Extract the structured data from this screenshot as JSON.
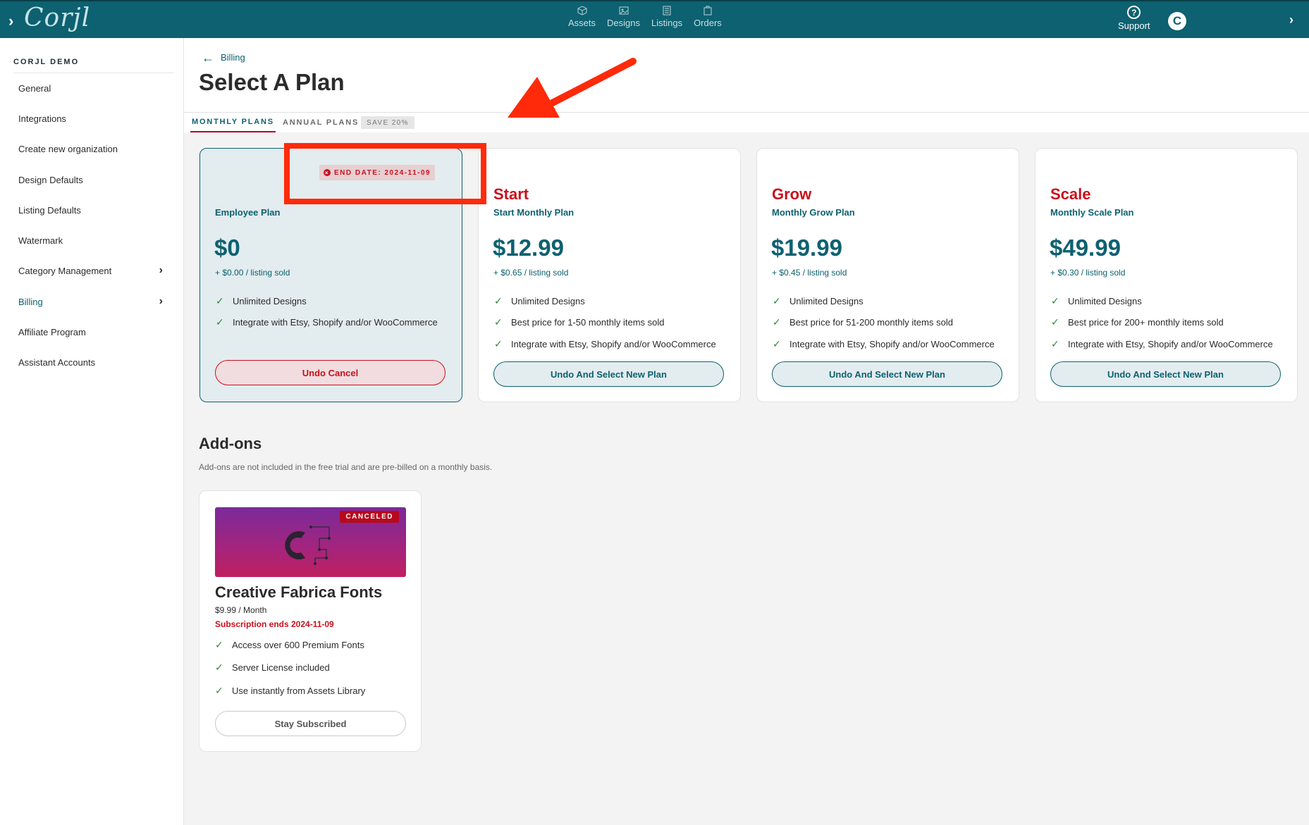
{
  "app": {
    "logo_text": "Corjl",
    "nav": [
      {
        "label": "Assets"
      },
      {
        "label": "Designs"
      },
      {
        "label": "Listings"
      },
      {
        "label": "Orders"
      }
    ],
    "support_label": "Support"
  },
  "sidebar": {
    "org_title": "CORJL DEMO",
    "items": [
      {
        "label": "General"
      },
      {
        "label": "Integrations"
      },
      {
        "label": "Create new organization"
      },
      {
        "label": "Design Defaults"
      },
      {
        "label": "Listing Defaults"
      },
      {
        "label": "Watermark"
      },
      {
        "label": "Category Management"
      },
      {
        "label": "Billing"
      },
      {
        "label": "Affiliate Program"
      },
      {
        "label": "Assistant Accounts"
      }
    ]
  },
  "header": {
    "back_label": "Billing",
    "title": "Select A Plan"
  },
  "tabs": {
    "monthly": "MONTHLY PLANS",
    "annual": "ANNUAL PLANS",
    "save_badge": "SAVE 20%"
  },
  "plans": [
    {
      "name": "",
      "subtitle": "Employee Plan",
      "price": "$0",
      "per_listing": "+ $0.00 / listing sold",
      "end_badge": "END DATE: 2024-11-09",
      "features": [
        "Unlimited Designs",
        "Integrate with Etsy, Shopify and/or WooCommerce"
      ],
      "button": "Undo Cancel"
    },
    {
      "name": "Start",
      "subtitle": "Start Monthly Plan",
      "price": "$12.99",
      "per_listing": "+ $0.65 / listing sold",
      "features": [
        "Unlimited Designs",
        "Best price for 1-50 monthly items sold",
        "Integrate with Etsy, Shopify and/or WooCommerce"
      ],
      "button": "Undo And Select New Plan"
    },
    {
      "name": "Grow",
      "subtitle": "Monthly Grow Plan",
      "price": "$19.99",
      "per_listing": "+ $0.45 / listing sold",
      "features": [
        "Unlimited Designs",
        "Best price for 51-200 monthly items sold",
        "Integrate with Etsy, Shopify and/or WooCommerce"
      ],
      "button": "Undo And Select New Plan"
    },
    {
      "name": "Scale",
      "subtitle": "Monthly Scale Plan",
      "price": "$49.99",
      "per_listing": "+ $0.30 / listing sold",
      "features": [
        "Unlimited Designs",
        "Best price for 200+ monthly items sold",
        "Integrate with Etsy, Shopify and/or WooCommerce"
      ],
      "button": "Undo And Select New Plan"
    }
  ],
  "addons": {
    "title": "Add-ons",
    "description": "Add-ons are not included in the free trial and are pre-billed on a monthly basis.",
    "items": [
      {
        "badge": "CANCELED",
        "name": "Creative Fabrica Fonts",
        "price": "$9.99 / Month",
        "ends": "Subscription ends 2024-11-09",
        "features": [
          "Access over 600 Premium Fonts",
          "Server License included",
          "Use instantly from Assets Library"
        ],
        "button": "Stay Subscribed"
      }
    ]
  },
  "colors": {
    "brand_teal": "#0d6170",
    "accent_red": "#c8101c",
    "annotation_red": "#ff2a0a",
    "check_green": "#2a8a3a"
  }
}
